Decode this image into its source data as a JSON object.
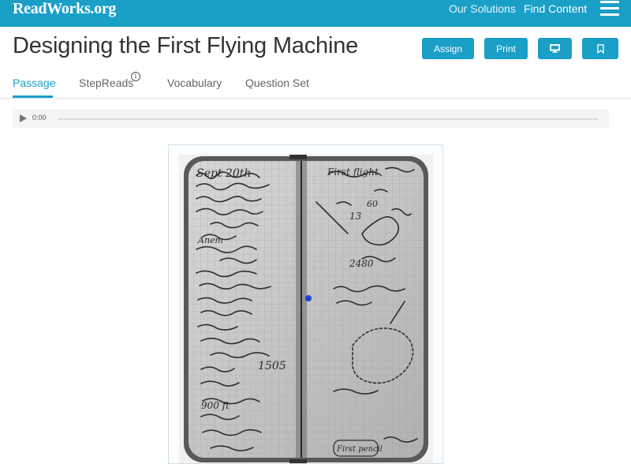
{
  "header": {
    "logo": "ReadWorks.org",
    "nav": {
      "our_solutions": "Our Solutions",
      "find_content": "Find Content"
    }
  },
  "page": {
    "title": "Designing the First Flying Machine",
    "buttons": {
      "assign": "Assign",
      "print": "Print"
    }
  },
  "tabs": [
    {
      "label": "Passage",
      "active": true
    },
    {
      "label": "StepReads"
    },
    {
      "label": "Vocabulary"
    },
    {
      "label": "Question Set"
    }
  ],
  "audio": {
    "time": "0:00"
  },
  "colors": {
    "brand": "#1a9fc7",
    "text": "#333333"
  },
  "icons": [
    "menu-icon",
    "monitor-icon",
    "bookmark-icon",
    "info-icon",
    "play-icon"
  ]
}
